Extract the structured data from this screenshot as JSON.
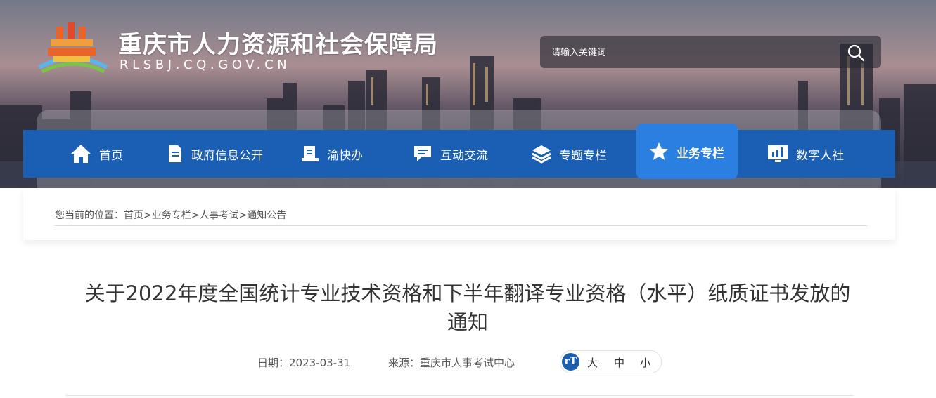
{
  "header": {
    "site_title": "重庆市人力资源和社会保障局",
    "site_domain": "RLSBJ.CQ.GOV.CN",
    "logo_icon": "building-logo-icon"
  },
  "search": {
    "placeholder": "请输入关键词",
    "icon": "search-icon"
  },
  "nav": {
    "items": [
      {
        "label": "首页",
        "icon": "home-icon"
      },
      {
        "label": "政府信息公开",
        "icon": "document-icon"
      },
      {
        "label": "渝快办",
        "icon": "clipboard-icon"
      },
      {
        "label": "互动交流",
        "icon": "chat-icon"
      },
      {
        "label": "专题专栏",
        "icon": "layers-icon"
      },
      {
        "label": "业务专栏",
        "icon": "star-icon",
        "active": true
      },
      {
        "label": "数字人社",
        "icon": "monitor-chart-icon"
      }
    ],
    "active_color": "#2b7fe0",
    "bar_color": "#1a5fb4"
  },
  "breadcrumb": {
    "prefix": "您当前的位置：",
    "items": [
      "首页",
      "业务专栏",
      "人事考试",
      "通知公告"
    ],
    "separator": ">"
  },
  "article": {
    "title_line1": "关于2022年度全国统计专业技术资格和下半年翻译专业资格（水平）纸质证书发放的",
    "title_line2": "通知",
    "date_label": "日期：",
    "date": "2023-03-31",
    "source_label": "来源：",
    "source": "重庆市人事考试中心",
    "font_size_icon": "font-size-icon",
    "font_sizes": [
      "大",
      "中",
      "小"
    ]
  }
}
